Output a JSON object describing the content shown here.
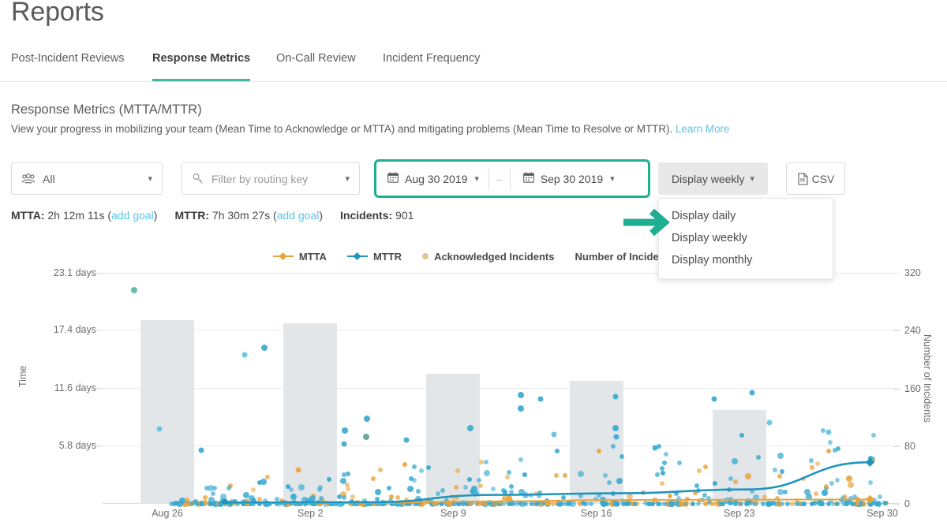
{
  "header": {
    "title": "Reports"
  },
  "tabs": [
    {
      "label": "Post-Incident Reviews",
      "active": false
    },
    {
      "label": "Response Metrics",
      "active": true
    },
    {
      "label": "On-Call Review",
      "active": false
    },
    {
      "label": "Incident Frequency",
      "active": false
    }
  ],
  "section": {
    "title": "Response Metrics (MTTA/MTTR)",
    "description": "View your progress in mobilizing your team (Mean Time to Acknowledge or MTTA) and mitigating problems (Mean Time to Resolve or MTTR).",
    "learn_more": "Learn More"
  },
  "toolbar": {
    "team_filter": {
      "value": "All",
      "icon": "team-icon"
    },
    "routing_filter": {
      "placeholder": "Filter by routing key",
      "icon": "key-icon"
    },
    "date_start": {
      "value": "Aug 30 2019",
      "icon": "calendar-icon"
    },
    "date_separator": "–",
    "date_end": {
      "value": "Sep 30 2019",
      "icon": "calendar-icon"
    },
    "display_toggle": {
      "value": "Display weekly",
      "icon": "chevron-down-icon"
    },
    "csv_button": {
      "label": "CSV",
      "icon": "document-icon"
    }
  },
  "dropdown_menu": {
    "open": true,
    "items": [
      "Display daily",
      "Display weekly",
      "Display monthly"
    ]
  },
  "stats": {
    "mtta_label": "MTTA:",
    "mtta_value": "2h 12m 11s",
    "mttr_label": "MTTR:",
    "mttr_value": "7h 30m 27s",
    "add_goal": "add goal",
    "incidents_label": "Incidents:",
    "incidents_value": "901"
  },
  "colors": {
    "accent_teal": "#1fae92",
    "tab_underline": "#3cb79e",
    "link_blue": "#5cc4e8",
    "mtta_orange": "#eaa33c",
    "mttr_blue": "#1f95bd",
    "acknowledged_tan": "#e8c49a",
    "incidents_bar": "#e3e6e8"
  },
  "chart_data": {
    "type": "bar",
    "title": "",
    "xlabel": "",
    "ylabel": "Time",
    "y2label": "Number of Incidents",
    "grid": true,
    "legend_position": "top-center",
    "legend": [
      {
        "name": "MTTA",
        "color": "#eaa33c",
        "marker": "line-diamond"
      },
      {
        "name": "MTTR",
        "color": "#1f95bd",
        "marker": "line-diamond"
      },
      {
        "name": "Acknowledged Incidents",
        "color": "#e8c49a",
        "marker": "dot"
      },
      {
        "name": "Number of Incidents",
        "color": "#e3e6e8",
        "marker": "bar"
      }
    ],
    "x_tick_labels": [
      "Aug 26",
      "Sep 2",
      "Sep 9",
      "Sep 16",
      "Sep 23",
      "Sep 30"
    ],
    "y_tick_labels": [
      "23.1 days",
      "17.4 days",
      "11.6 days",
      "5.8 days"
    ],
    "y_tick_values": [
      23.1,
      17.4,
      11.6,
      5.8
    ],
    "ylim": [
      0,
      23.1
    ],
    "y2_tick_labels": [
      "320",
      "240",
      "160",
      "80",
      "0"
    ],
    "y2_tick_values": [
      320,
      240,
      160,
      80,
      0
    ],
    "y2lim": [
      0,
      320
    ],
    "categories": [
      "Aug 26",
      "Sep 2",
      "Sep 9",
      "Sep 16",
      "Sep 23"
    ],
    "values": [
      255,
      250,
      180,
      170,
      130
    ],
    "series": [
      {
        "name": "Number of Incidents",
        "type": "bar",
        "values": [
          255,
          250,
          180,
          170,
          130
        ]
      },
      {
        "name": "MTTA",
        "type": "line",
        "color": "#eaa33c",
        "points": [
          [
            0.08,
            0.02
          ],
          [
            0.28,
            0.03
          ],
          [
            0.45,
            0.08
          ],
          [
            0.62,
            0.12
          ],
          [
            0.8,
            0.13
          ],
          [
            0.97,
            0.14
          ]
        ]
      },
      {
        "name": "MTTR",
        "type": "line",
        "color": "#1f95bd",
        "points": [
          [
            0.08,
            0.04
          ],
          [
            0.28,
            0.05
          ],
          [
            0.45,
            0.28
          ],
          [
            0.62,
            0.33
          ],
          [
            0.8,
            0.45
          ],
          [
            0.97,
            1.3
          ]
        ]
      }
    ],
    "scatter_note": "Dense scatter of individual incident acknowledge/resolve times near baseline, with outliers up to 23 days."
  }
}
